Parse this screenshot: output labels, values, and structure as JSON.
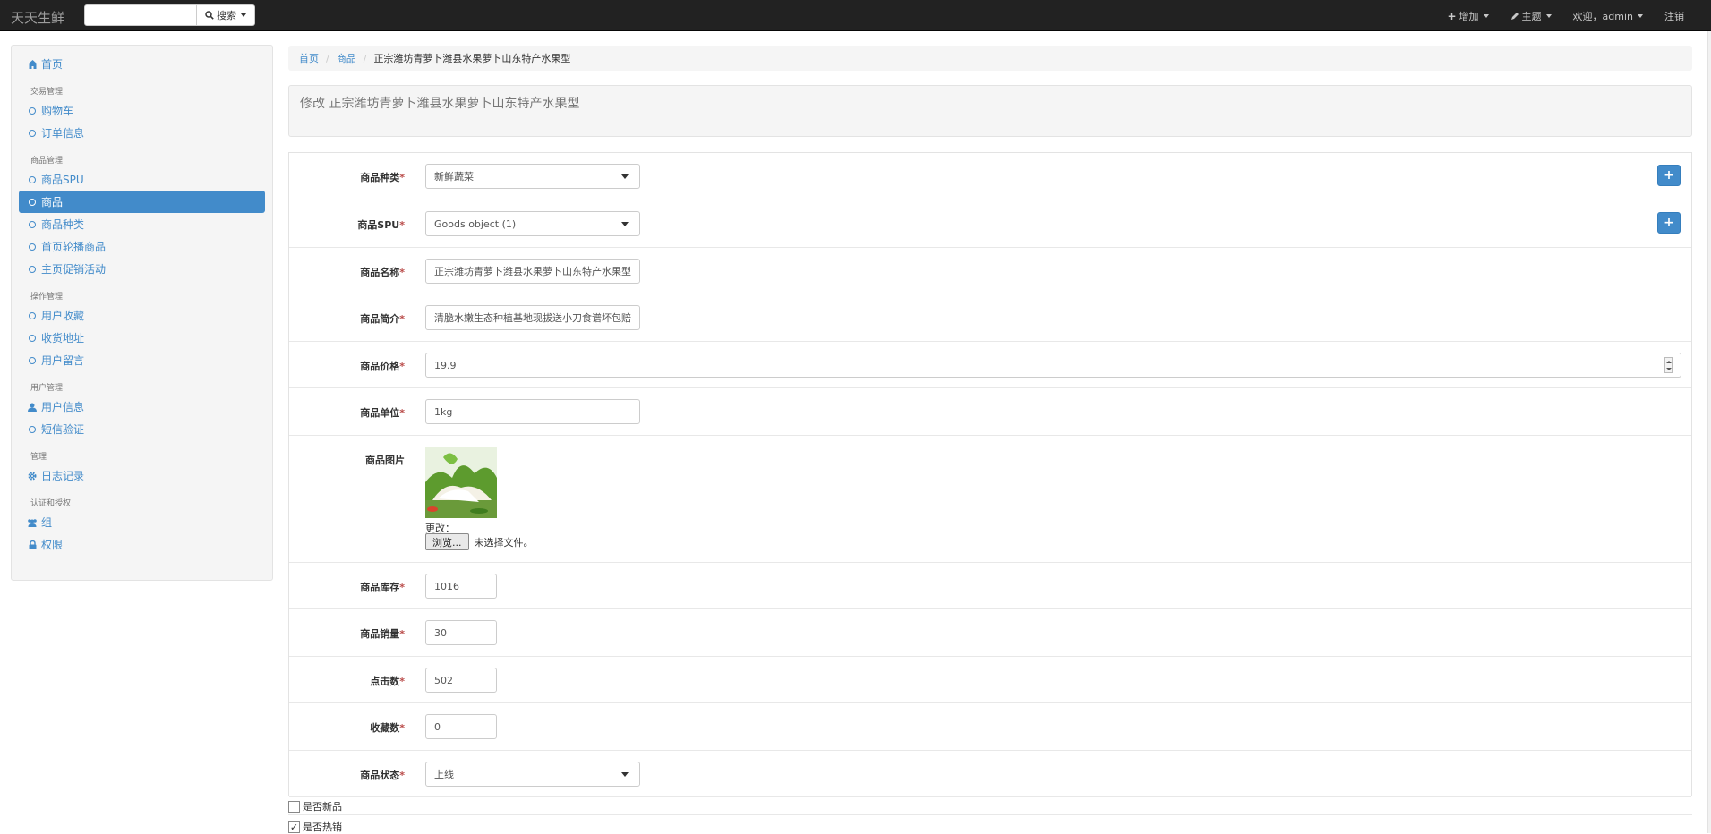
{
  "navbar": {
    "brand": "天天生鲜",
    "search_placeholder": "",
    "search_button": "搜索",
    "add_menu": "增加",
    "theme_menu": "主题",
    "welcome": "欢迎，admin",
    "logout": "注销"
  },
  "sidebar": {
    "home": "首页",
    "sections": [
      {
        "header": "交易管理",
        "items": [
          "购物车",
          "订单信息"
        ]
      },
      {
        "header": "商品管理",
        "items": [
          "商品SPU",
          "商品",
          "商品种类",
          "首页轮播商品",
          "主页促销活动"
        ]
      },
      {
        "header": "操作管理",
        "items": [
          "用户收藏",
          "收货地址",
          "用户留言"
        ]
      },
      {
        "header": "用户管理",
        "items": [
          "用户信息",
          "短信验证"
        ]
      },
      {
        "header": "管理",
        "items": [
          "日志记录"
        ]
      },
      {
        "header": "认证和授权",
        "items": [
          "组",
          "权限"
        ]
      }
    ],
    "active_item": "商品"
  },
  "breadcrumb": [
    "首页",
    "商品",
    "正宗潍坊青萝卜潍县水果萝卜山东特产水果型"
  ],
  "page_title": "修改 正宗潍坊青萝卜潍县水果萝卜山东特产水果型",
  "form": {
    "category": {
      "label": "商品种类",
      "value": "新鲜蔬菜"
    },
    "spu": {
      "label": "商品SPU",
      "value": "Goods object (1)"
    },
    "name": {
      "label": "商品名称",
      "value": "正宗潍坊青萝卜潍县水果萝卜山东特产水果型"
    },
    "desc": {
      "label": "商品简介",
      "value": "清脆水嫩生态种植基地现拔送小刀食谱坏包赔"
    },
    "price": {
      "label": "商品价格",
      "value": "19.9"
    },
    "unit": {
      "label": "商品单位",
      "value": "1kg"
    },
    "image": {
      "label": "商品图片",
      "change_label": "更改：",
      "browse_button": "浏览...",
      "file_status": "未选择文件。"
    },
    "stock": {
      "label": "商品库存",
      "value": "1016"
    },
    "sales": {
      "label": "商品销量",
      "value": "30"
    },
    "clicks": {
      "label": "点击数",
      "value": "502"
    },
    "favorites": {
      "label": "收藏数",
      "value": "0"
    },
    "status": {
      "label": "商品状态",
      "value": "上线"
    },
    "is_new": {
      "label": "是否新品",
      "checked": false
    },
    "is_hot": {
      "label": "是否热销",
      "checked": true
    }
  },
  "colors": {
    "primary": "#428bca",
    "navbar": "#222222",
    "required": "#b94a48"
  },
  "icons": [
    "home-icon",
    "circle-icon",
    "user-icon",
    "gear-icon",
    "group-icon",
    "lock-icon",
    "search-icon",
    "plus-icon",
    "pencil-icon"
  ]
}
